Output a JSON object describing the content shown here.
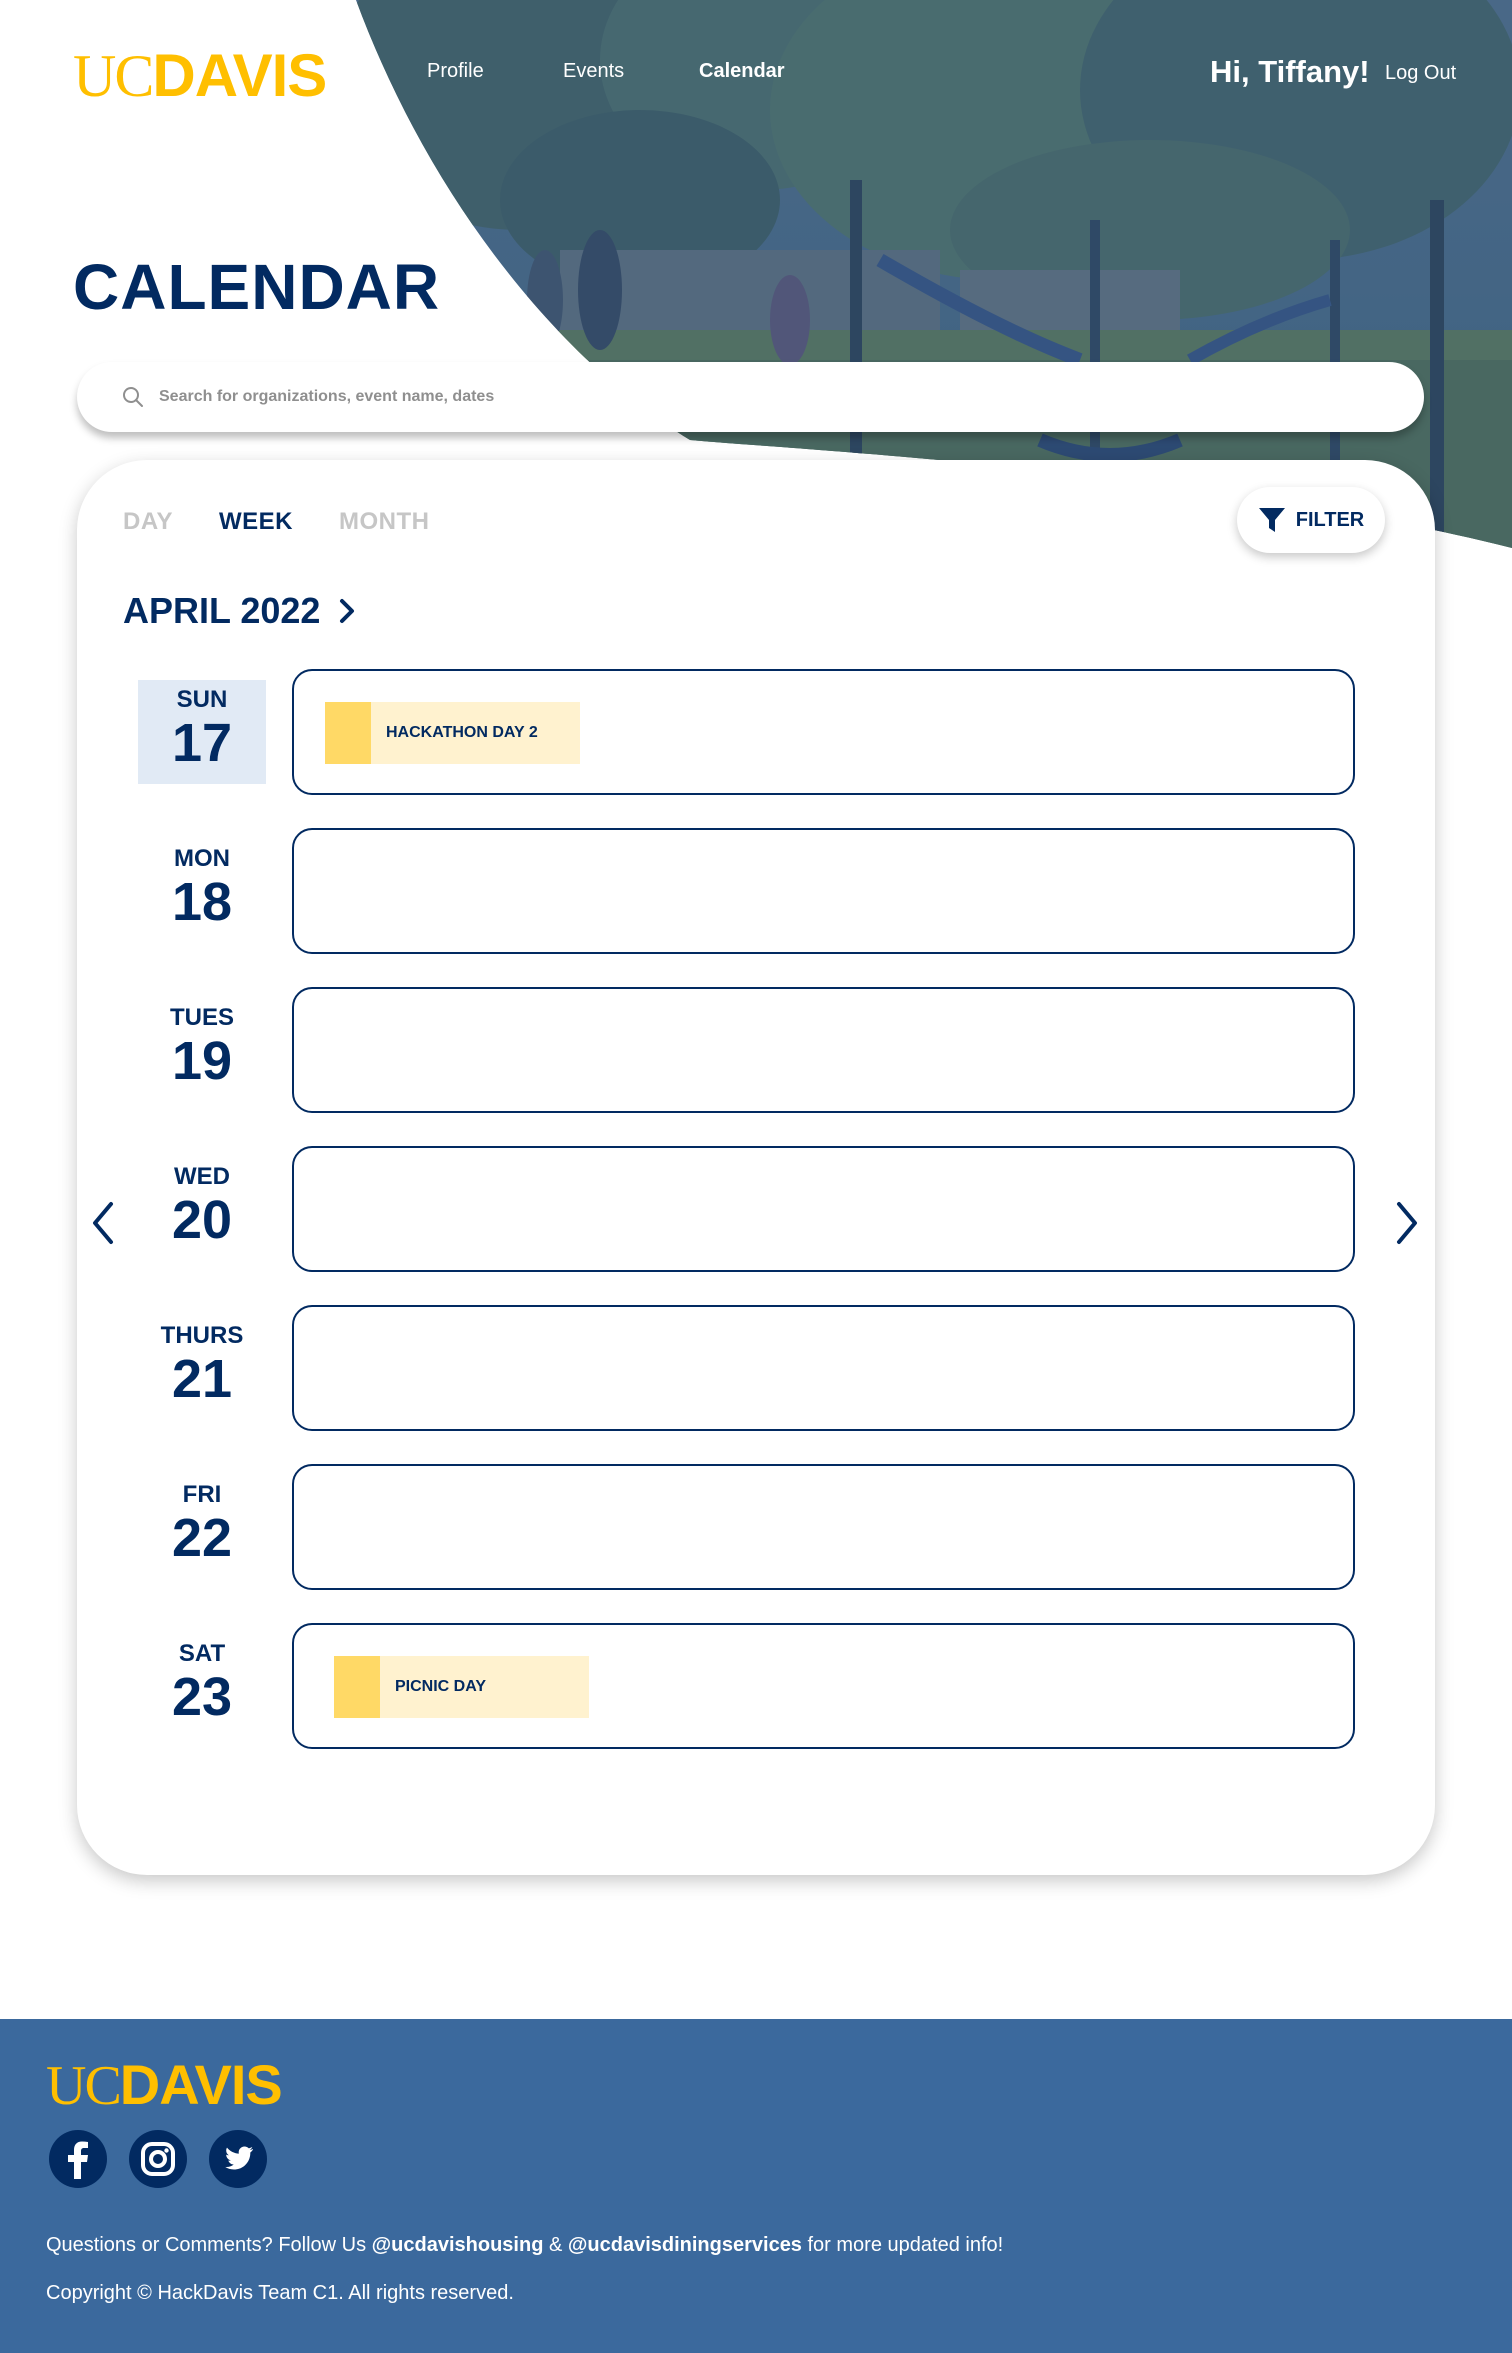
{
  "header": {
    "logo_uc": "UC",
    "logo_davis": "DAVIS",
    "nav": [
      {
        "label": "Profile",
        "active": false
      },
      {
        "label": "Events",
        "active": false
      },
      {
        "label": "Calendar",
        "active": true
      }
    ],
    "greeting": "Hi, Tiffany!",
    "logout_label": "Log Out"
  },
  "page_title": "CALENDAR",
  "search": {
    "placeholder": "Search for organizations, event name, dates",
    "icon": "search-icon"
  },
  "calendar": {
    "view_tabs": [
      {
        "label": "DAY",
        "active": false
      },
      {
        "label": "WEEK",
        "active": true
      },
      {
        "label": "MONTH",
        "active": false
      }
    ],
    "filter_label": "FILTER",
    "month_label": "APRIL 2022",
    "days": [
      {
        "name": "SUN",
        "number": "17",
        "today": true,
        "events": [
          "HACKATHON DAY 2"
        ]
      },
      {
        "name": "MON",
        "number": "18",
        "today": false,
        "events": []
      },
      {
        "name": "TUES",
        "number": "19",
        "today": false,
        "events": []
      },
      {
        "name": "WED",
        "number": "20",
        "today": false,
        "events": []
      },
      {
        "name": "THURS",
        "number": "21",
        "today": false,
        "events": []
      },
      {
        "name": "FRI",
        "number": "22",
        "today": false,
        "events": []
      },
      {
        "name": "SAT",
        "number": "23",
        "today": false,
        "events": [
          "PICNIC DAY"
        ]
      }
    ]
  },
  "footer": {
    "logo_uc": "UC",
    "logo_davis": "DAVIS",
    "socials": [
      "facebook-icon",
      "instagram-icon",
      "twitter-icon"
    ],
    "questions_prefix": "Questions or Comments? Follow Us",
    "handle_housing": "@ucdavishousing",
    "amp": "&",
    "handle_dining": "@ucdavisdiningservices",
    "questions_suffix": "for more updated info!",
    "copyright": "Copyright © HackDavis Team C1. All rights reserved."
  },
  "colors": {
    "navy": "#022A61",
    "gold": "#FFBF00",
    "footer_blue": "#3B699D",
    "event_accent": "#FFD966",
    "event_bg": "#FFF2CF",
    "today_bg": "#E1EAF5"
  }
}
